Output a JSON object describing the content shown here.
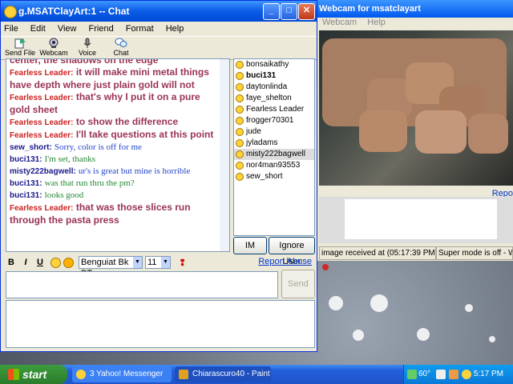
{
  "chat_window": {
    "title": "g.MSATClayArt:1 -- Chat",
    "menu": [
      "File",
      "Edit",
      "View",
      "Friend",
      "Format",
      "Help"
    ],
    "toolbar": [
      "Send File",
      "Webcam",
      "Voice",
      "Chat"
    ],
    "messages": [
      {
        "speaker": "",
        "text": "center, the shadows on the edge",
        "color": "#993355",
        "bold": true
      },
      {
        "speaker": "Fearless Leader:",
        "text": "it will make mini metal things have depth where just plain gold will not",
        "color": "#993355",
        "bold": true
      },
      {
        "speaker": "Fearless Leader:",
        "text": "that's why I put it on a pure gold sheet",
        "color": "#993355",
        "bold": true
      },
      {
        "speaker": "Fearless Leader:",
        "text": "to show the difference",
        "color": "#993355",
        "bold": true
      },
      {
        "speaker": "Fearless Leader:",
        "text": "I'll take questions at this point",
        "color": "#993355",
        "bold": true
      },
      {
        "speaker": "sew_short:",
        "text": "Sorry, color is off for me",
        "color": "#2244cc",
        "bold": false
      },
      {
        "speaker": "buci131:",
        "text": "I'm set, thanks",
        "color": "#228833",
        "bold": false
      },
      {
        "speaker": "misty222bagwell:",
        "text": "ur's is great but mine is horrible",
        "color": "#2244cc",
        "bold": false
      },
      {
        "speaker": "buci131:",
        "text": "was that run thru the pm?",
        "color": "#228833",
        "bold": false
      },
      {
        "speaker": "buci131:",
        "text": "looks good",
        "color": "#228833",
        "bold": false
      },
      {
        "speaker": "Fearless Leader:",
        "text": "that was those slices run through the pasta press",
        "color": "#993355",
        "bold": true
      }
    ],
    "users": [
      {
        "name": "bonsaikathy",
        "selected": false,
        "bold": false
      },
      {
        "name": "buci131",
        "selected": false,
        "bold": true
      },
      {
        "name": "daytonlinda",
        "selected": false,
        "bold": false
      },
      {
        "name": "faye_shelton",
        "selected": false,
        "bold": false
      },
      {
        "name": "Fearless Leader",
        "selected": false,
        "bold": false
      },
      {
        "name": "frogger70301",
        "selected": false,
        "bold": false
      },
      {
        "name": "jude",
        "selected": false,
        "bold": false
      },
      {
        "name": "jyladams",
        "selected": false,
        "bold": false
      },
      {
        "name": "misty222bagwell",
        "selected": true,
        "bold": false
      },
      {
        "name": "nor4man93553",
        "selected": false,
        "bold": false
      },
      {
        "name": "sew_short",
        "selected": false,
        "bold": false
      }
    ],
    "im_label": "IM",
    "ignore_label": "Ignore User",
    "format": {
      "bold": "B",
      "italic": "I",
      "underline": "U",
      "font": "Benguiat Bk BT",
      "size": "11"
    },
    "report_abuse": "Report Abuse",
    "send_label": "Send"
  },
  "webcam_window": {
    "title": "Webcam for msatclayart",
    "menu": [
      "Webcam",
      "Help"
    ],
    "report_link": "Repo",
    "status_received": "image received at (05:17:39 PM)",
    "status_super": "Super mode is off - What"
  },
  "taskbar": {
    "start_label": "start",
    "tasks": [
      "3 Yahoo! Messenger",
      "Chiarascuro40 - Paint"
    ],
    "temperature": "60°",
    "clock": "5:17 PM"
  }
}
